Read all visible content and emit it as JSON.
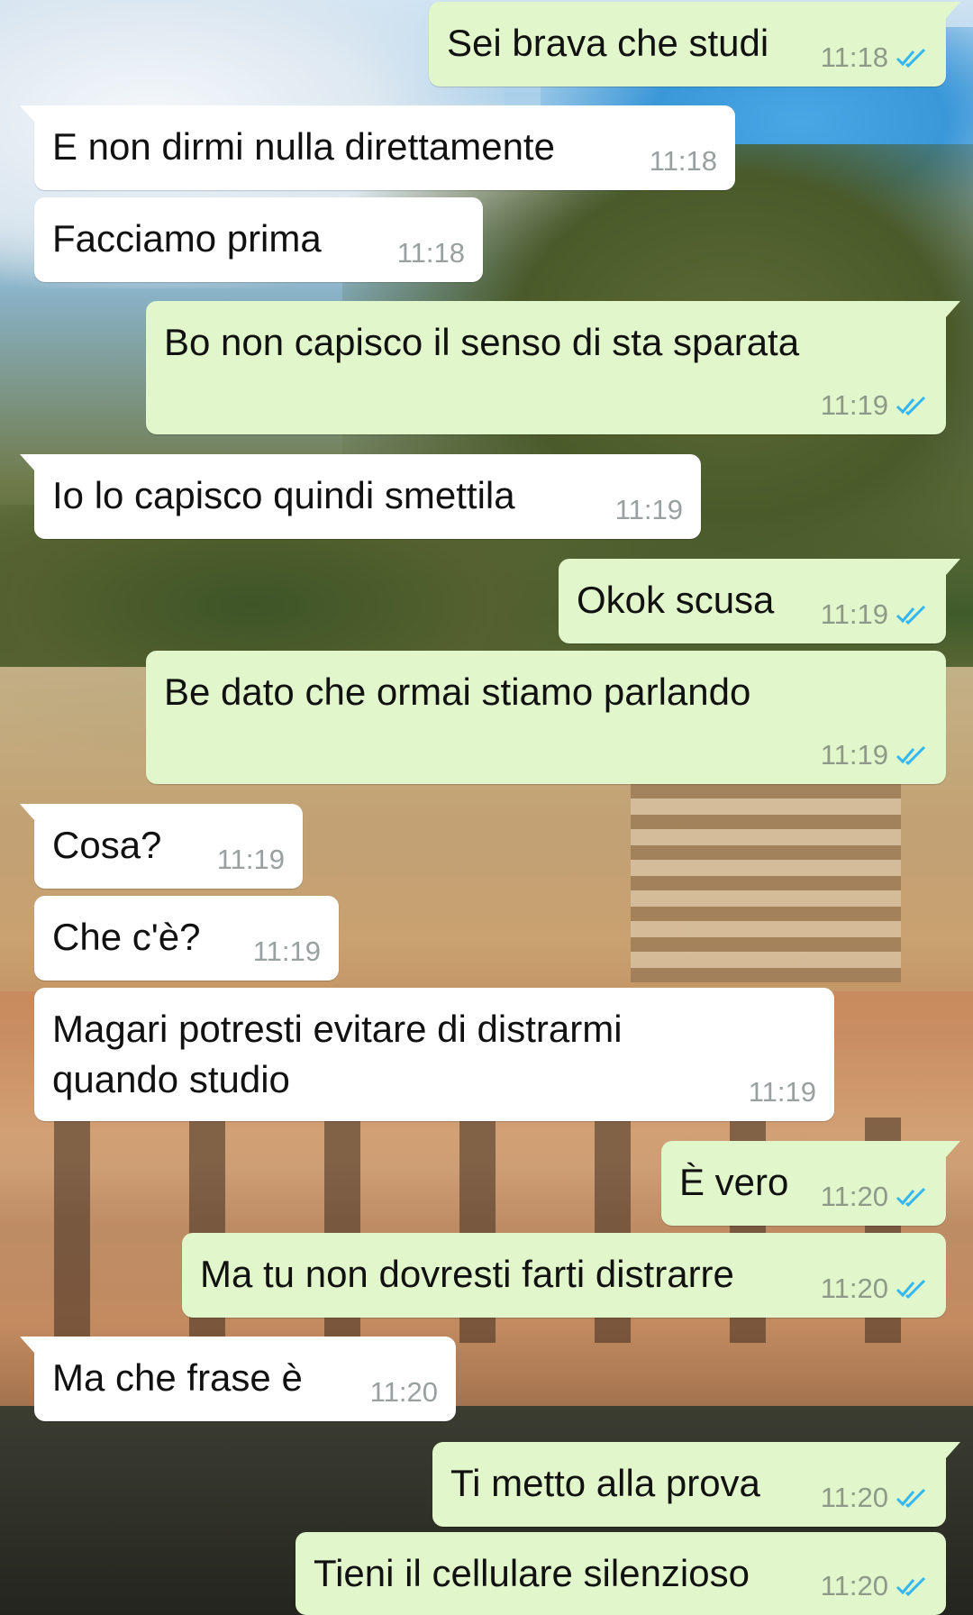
{
  "messages": [
    {
      "side": "out",
      "text": "Sei brava che studi",
      "time": "11:18",
      "status": "read-double-check-icon"
    },
    {
      "side": "in",
      "text": "E non dirmi nulla direttamente",
      "time": "11:18"
    },
    {
      "side": "in",
      "text": "Facciamo prima",
      "time": "11:18"
    },
    {
      "side": "out",
      "text": "Bo non capisco il senso di sta sparata",
      "time": "11:19",
      "status": "read-double-check-icon"
    },
    {
      "side": "in",
      "text": "Io lo capisco quindi smettila",
      "time": "11:19"
    },
    {
      "side": "out",
      "text": "Okok scusa",
      "time": "11:19",
      "status": "read-double-check-icon"
    },
    {
      "side": "out",
      "text": "Be dato che ormai stiamo parlando",
      "time": "11:19",
      "status": "read-double-check-icon"
    },
    {
      "side": "in",
      "text": "Cosa?",
      "time": "11:19"
    },
    {
      "side": "in",
      "text": "Che c'è?",
      "time": "11:19"
    },
    {
      "side": "in",
      "text": "Magari potresti evitare di distrarmi quando studio",
      "time": "11:19"
    },
    {
      "side": "out",
      "text": "È vero",
      "time": "11:20",
      "status": "read-double-check-icon"
    },
    {
      "side": "out",
      "text": "Ma tu non dovresti farti distrarre",
      "time": "11:20",
      "status": "read-double-check-icon"
    },
    {
      "side": "in",
      "text": "Ma che frase è",
      "time": "11:20"
    },
    {
      "side": "out",
      "text": "Ti metto alla prova",
      "time": "11:20",
      "status": "read-double-check-icon"
    },
    {
      "side": "out",
      "text": "Tieni il cellulare silenzioso",
      "time": "11:20",
      "status": "read-double-check-icon"
    }
  ],
  "colors": {
    "incoming_bubble": "#ffffff",
    "outgoing_bubble": "#e1f7cb",
    "read_check": "#34b7f1",
    "timestamp": "#8d9a8a"
  }
}
